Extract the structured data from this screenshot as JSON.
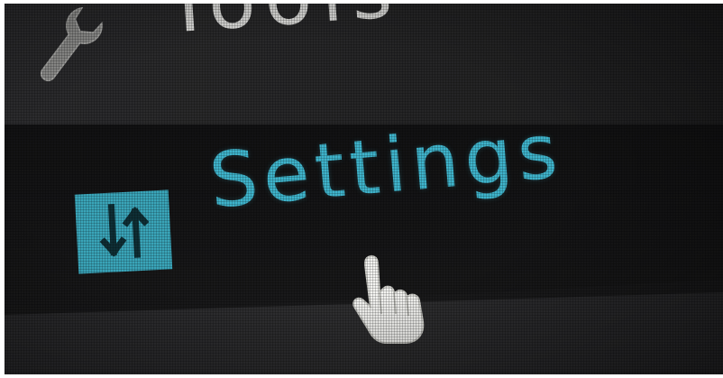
{
  "menu": {
    "items": [
      {
        "label": "Tools",
        "icon": "wrench-icon"
      },
      {
        "label": "Settings",
        "icon": "sort-arrows-icon"
      }
    ]
  },
  "cursor": {
    "icon": "hand-pointer-icon"
  },
  "colors": {
    "accent": "#3fb4cc",
    "icon_background": "#3aa5b9",
    "menu_text": "#d8d8d6",
    "background": "#1b1b1c"
  }
}
